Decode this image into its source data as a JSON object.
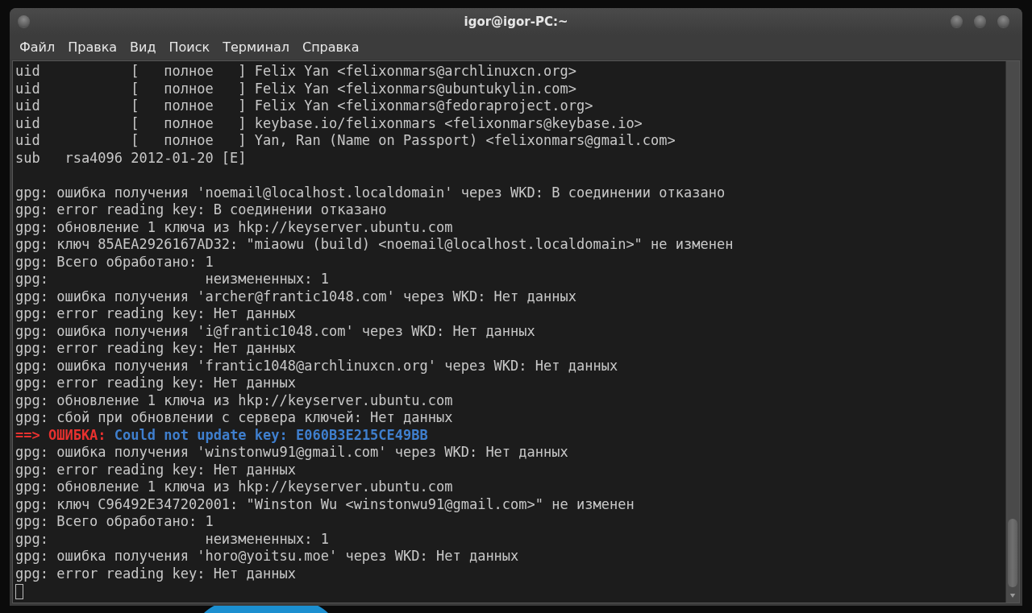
{
  "window": {
    "title": "igor@igor-PC:~"
  },
  "menu": [
    {
      "label": "Файл"
    },
    {
      "label": "Правка"
    },
    {
      "label": "Вид"
    },
    {
      "label": "Поиск"
    },
    {
      "label": "Терминал"
    },
    {
      "label": "Справка"
    }
  ],
  "terminal": {
    "lines": [
      {
        "kind": "plain",
        "text": "uid           [   полное   ] Felix Yan <felixonmars@archlinuxcn.org>"
      },
      {
        "kind": "plain",
        "text": "uid           [   полное   ] Felix Yan <felixonmars@ubuntukylin.com>"
      },
      {
        "kind": "plain",
        "text": "uid           [   полное   ] Felix Yan <felixonmars@fedoraproject.org>"
      },
      {
        "kind": "plain",
        "text": "uid           [   полное   ] keybase.io/felixonmars <felixonmars@keybase.io>"
      },
      {
        "kind": "plain",
        "text": "uid           [   полное   ] Yan, Ran (Name on Passport) <felixonmars@gmail.com>"
      },
      {
        "kind": "plain",
        "text": "sub   rsa4096 2012-01-20 [E]"
      },
      {
        "kind": "blank"
      },
      {
        "kind": "plain",
        "text": "gpg: ошибка получения 'noemail@localhost.localdomain' через WKD: В соединении отказано"
      },
      {
        "kind": "plain",
        "text": "gpg: error reading key: В соединении отказано"
      },
      {
        "kind": "plain",
        "text": "gpg: обновление 1 ключа из hkp://keyserver.ubuntu.com"
      },
      {
        "kind": "plain",
        "text": "gpg: ключ 85AEA2926167AD32: \"miaowu (build) <noemail@localhost.localdomain>\" не изменен"
      },
      {
        "kind": "plain",
        "text": "gpg: Всего обработано: 1"
      },
      {
        "kind": "plain",
        "text": "gpg:                   неизмененных: 1"
      },
      {
        "kind": "plain",
        "text": "gpg: ошибка получения 'archer@frantic1048.com' через WKD: Нет данных"
      },
      {
        "kind": "plain",
        "text": "gpg: error reading key: Нет данных"
      },
      {
        "kind": "plain",
        "text": "gpg: ошибка получения 'i@frantic1048.com' через WKD: Нет данных"
      },
      {
        "kind": "plain",
        "text": "gpg: error reading key: Нет данных"
      },
      {
        "kind": "plain",
        "text": "gpg: ошибка получения 'frantic1048@archlinuxcn.org' через WKD: Нет данных"
      },
      {
        "kind": "plain",
        "text": "gpg: error reading key: Нет данных"
      },
      {
        "kind": "plain",
        "text": "gpg: обновление 1 ключа из hkp://keyserver.ubuntu.com"
      },
      {
        "kind": "plain",
        "text": "gpg: сбой при обновлении с сервера ключей: Нет данных"
      },
      {
        "kind": "error",
        "prefix": "==> ОШИБКА:",
        "text": "Could not update key: E060B3E215CE49BB"
      },
      {
        "kind": "plain",
        "text": "gpg: ошибка получения 'winstonwu91@gmail.com' через WKD: Нет данных"
      },
      {
        "kind": "plain",
        "text": "gpg: error reading key: Нет данных"
      },
      {
        "kind": "plain",
        "text": "gpg: обновление 1 ключа из hkp://keyserver.ubuntu.com"
      },
      {
        "kind": "plain",
        "text": "gpg: ключ C96492E347202001: \"Winston Wu <winstonwu91@gmail.com>\" не изменен"
      },
      {
        "kind": "plain",
        "text": "gpg: Всего обработано: 1"
      },
      {
        "kind": "plain",
        "text": "gpg:                   неизмененных: 1"
      },
      {
        "kind": "plain",
        "text": "gpg: ошибка получения 'horo@yoitsu.moe' через WKD: Нет данных"
      },
      {
        "kind": "plain",
        "text": "gpg: error reading key: Нет данных"
      },
      {
        "kind": "cursor"
      }
    ]
  }
}
